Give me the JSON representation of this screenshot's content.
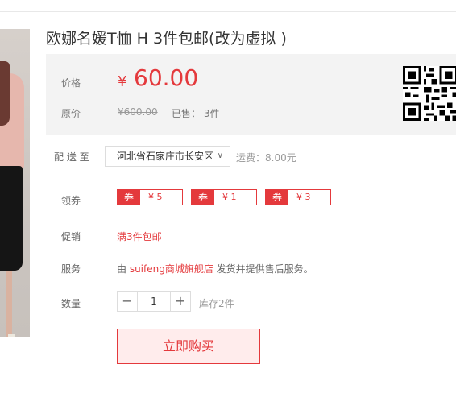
{
  "product": {
    "title": "欧娜名媛T恤 H 3件包邮(改为虚拟 )"
  },
  "price": {
    "label": "价格",
    "currency": "¥",
    "value": "60.00",
    "original_label": "原价",
    "original_value": "¥600.00",
    "sold_label": "已售：",
    "sold_value": "3件"
  },
  "delivery": {
    "label": "配 送 至",
    "address": "河北省石家庄市长安区",
    "fee": "运费：8.00元"
  },
  "coupons": {
    "label": "领券",
    "items": [
      {
        "tag": "券",
        "amount": "¥ 5"
      },
      {
        "tag": "券",
        "amount": "¥ 1"
      },
      {
        "tag": "券",
        "amount": "¥ 3"
      }
    ]
  },
  "promotion": {
    "label": "促销",
    "text": "满3件包邮"
  },
  "service": {
    "label": "服务",
    "prefix": "由 ",
    "shop": "suifeng商城旗舰店",
    "suffix": " 发货并提供售后服务。"
  },
  "quantity": {
    "label": "数量",
    "minus": "−",
    "plus": "+",
    "value": "1",
    "stock": "库存2件"
  },
  "actions": {
    "buy_now": "立即购买"
  },
  "colors": {
    "accent": "#e4393c",
    "price_bg": "#f3f3f3"
  },
  "icons": {
    "qr": "qr-code-icon",
    "dropdown": "chevron-down-icon"
  }
}
